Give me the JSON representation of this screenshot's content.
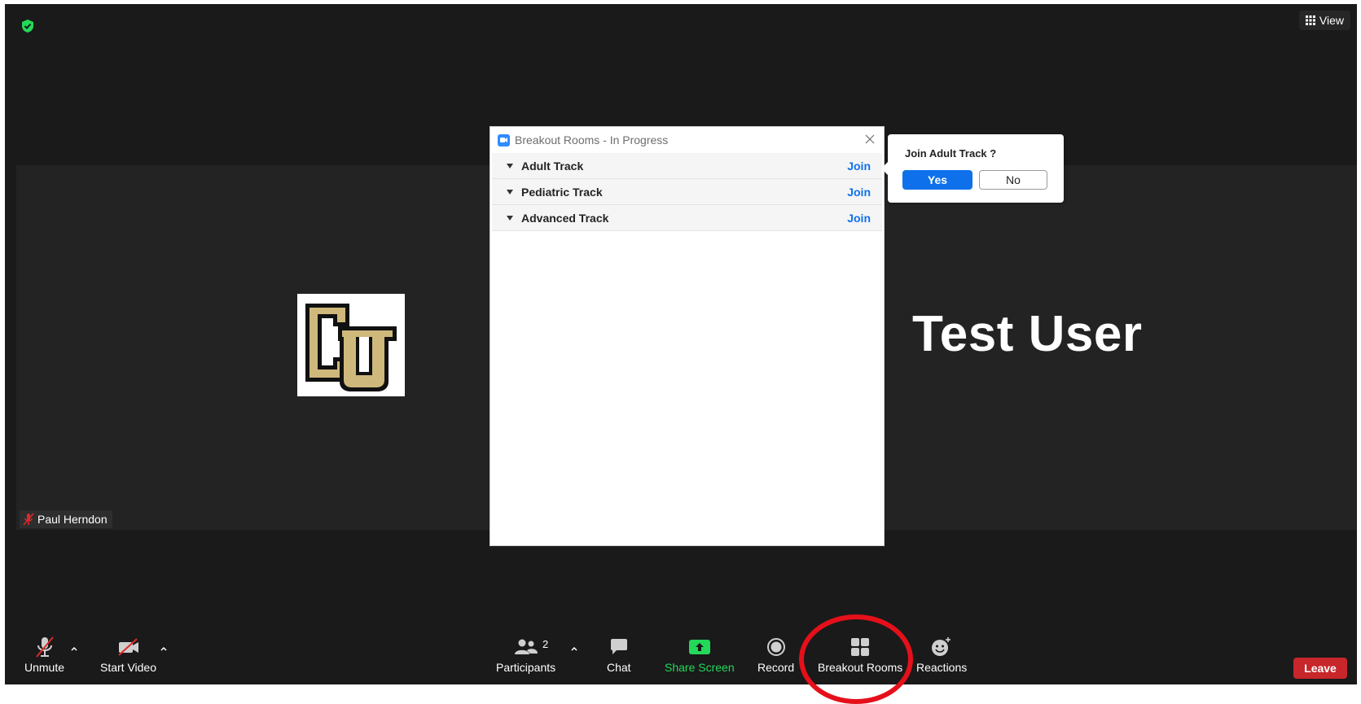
{
  "top_bar": {
    "view_label": "View"
  },
  "video": {
    "participant_name": "Test User",
    "name_tag": "Paul Herndon"
  },
  "breakout_dialog": {
    "title": "Breakout Rooms - In Progress",
    "rooms": [
      {
        "name": "Adult Track",
        "join_label": "Join"
      },
      {
        "name": "Pediatric Track",
        "join_label": "Join"
      },
      {
        "name": "Advanced Track",
        "join_label": "Join"
      }
    ]
  },
  "join_popover": {
    "question": "Join Adult Track ?",
    "yes_label": "Yes",
    "no_label": "No"
  },
  "toolbar": {
    "unmute_label": "Unmute",
    "start_video_label": "Start Video",
    "participants_label": "Participants",
    "participants_count": "2",
    "chat_label": "Chat",
    "share_screen_label": "Share Screen",
    "record_label": "Record",
    "breakout_rooms_label": "Breakout Rooms",
    "reactions_label": "Reactions",
    "leave_label": "Leave"
  },
  "colors": {
    "background": "#1a1a1a",
    "accent_blue": "#0e71eb",
    "share_green": "#23d959",
    "leave_red": "#c7262b",
    "highlight_red": "#e5101a",
    "cu_gold": "#cfb87c"
  }
}
